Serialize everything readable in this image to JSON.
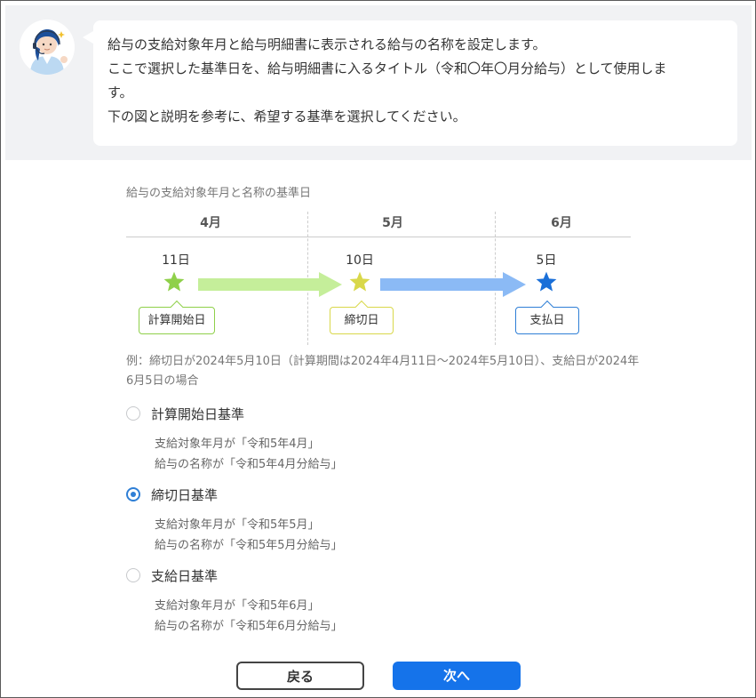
{
  "header": {
    "lines": [
      "給与の支給対象年月と給与明細書に表示される給与の名称を設定します。",
      "ここで選択した基準日を、給与明細書に入るタイトル（令和〇年〇月分給与）として使用しま",
      "す。",
      "下の図と説明を参考に、希望する基準を選択してください。"
    ]
  },
  "diagram": {
    "title": "給与の支給対象年月と名称の基準日",
    "months": [
      "4月",
      "5月",
      "6月"
    ],
    "points": [
      {
        "day": "11日",
        "label": "計算開始日",
        "color": "#8fd04a"
      },
      {
        "day": "10日",
        "label": "締切日",
        "color": "#d9d84a"
      },
      {
        "day": "5日",
        "label": "支払日",
        "color": "#1a6fd8"
      }
    ],
    "arrow_colors": {
      "green": "#c5ee9a",
      "blue": "#8bbaf5"
    }
  },
  "example": "例：締切日が2024年5月10日（計算期間は2024年4月11日〜2024年5月10日）、支給日が2024年6月5日の場合",
  "options": [
    {
      "label": "計算開始日基準",
      "selected": false,
      "detail1": "支給対象年月が「令和5年4月」",
      "detail2": "給与の名称が「令和5年4月分給与」"
    },
    {
      "label": "締切日基準",
      "selected": true,
      "detail1": "支給対象年月が「令和5年5月」",
      "detail2": "給与の名称が「令和5年5月分給与」"
    },
    {
      "label": "支給日基準",
      "selected": false,
      "detail1": "支給対象年月が「令和5年6月」",
      "detail2": "給与の名称が「令和5年6月分給与」"
    }
  ],
  "buttons": {
    "back": "戻る",
    "next": "次へ"
  },
  "colors": {
    "accent": "#1573ea",
    "radio": "#2f7fd6"
  }
}
